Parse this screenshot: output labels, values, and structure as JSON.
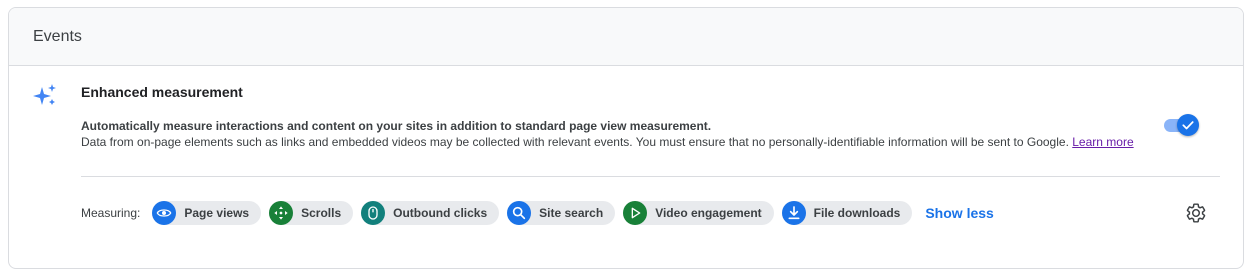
{
  "card": {
    "title": "Events"
  },
  "enhanced": {
    "title": "Enhanced measurement",
    "description_bold": "Automatically measure interactions and content on your sites in addition to standard page view measurement.",
    "description": "Data from on-page elements such as links and embedded videos may be collected with relevant events. You must ensure that no personally-identifiable information will be sent to Google.",
    "learn_more": "Learn more",
    "toggle_on": true
  },
  "measuring": {
    "label": "Measuring:",
    "chips": [
      {
        "label": "Page views",
        "icon": "eye-icon",
        "color": "#1a73e8"
      },
      {
        "label": "Scrolls",
        "icon": "scroll-icon",
        "color": "#188038"
      },
      {
        "label": "Outbound clicks",
        "icon": "mouse-icon",
        "color": "#12807c"
      },
      {
        "label": "Site search",
        "icon": "search-icon",
        "color": "#1a73e8"
      },
      {
        "label": "Video engagement",
        "icon": "play-icon",
        "color": "#188038"
      },
      {
        "label": "File downloads",
        "icon": "download-icon",
        "color": "#1a73e8"
      }
    ],
    "show_less": "Show less"
  },
  "colors": {
    "accent": "#1a73e8",
    "chip_bg": "#e8eaed",
    "header_bg": "#f8f9fa"
  }
}
